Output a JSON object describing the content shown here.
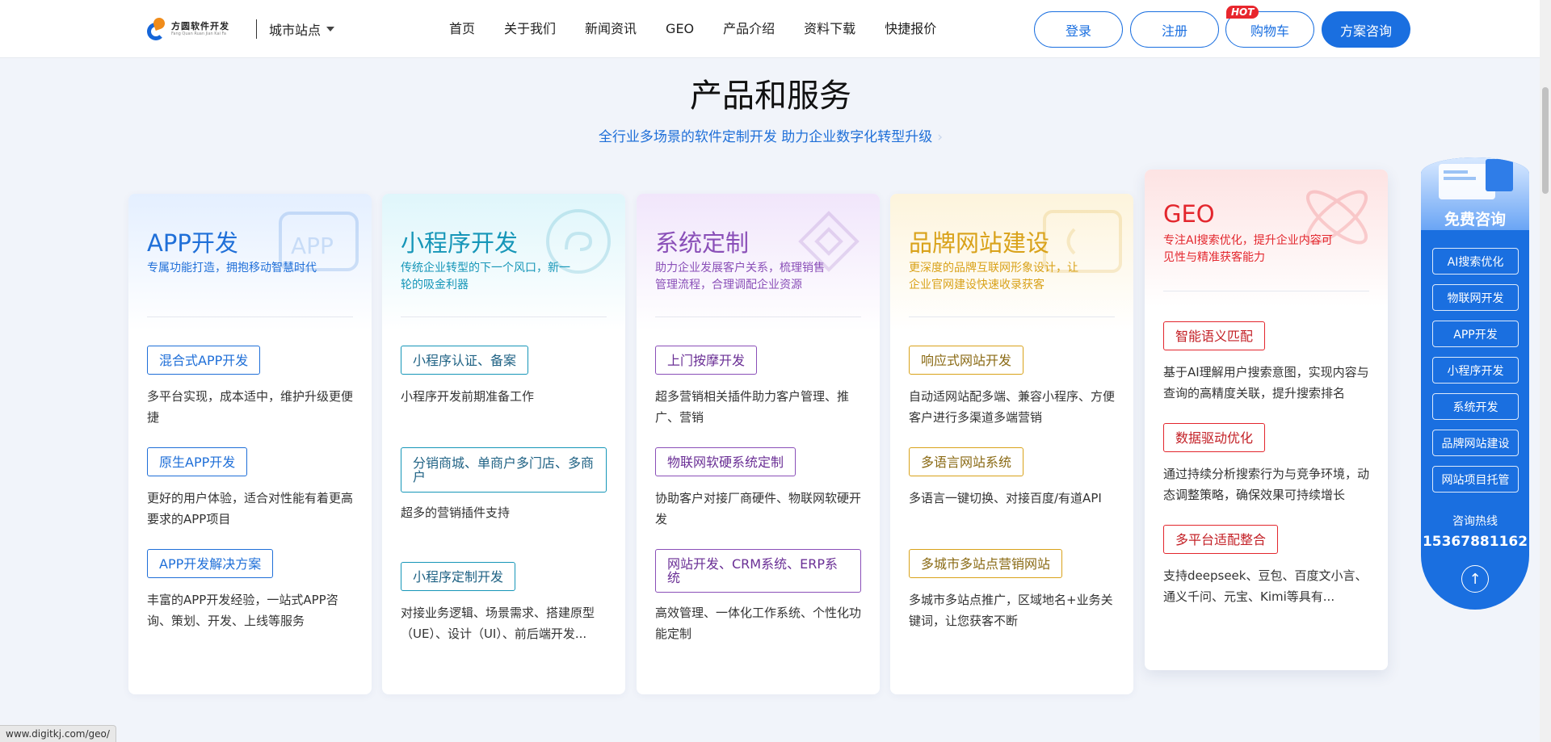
{
  "header": {
    "logo_cn": "方圆软件开发",
    "logo_en": "Fang Quan Ruan Jian Kai Fa",
    "city": "城市站点",
    "nav": [
      "首页",
      "关于我们",
      "新闻资讯",
      "GEO",
      "产品介绍",
      "资料下载",
      "快捷报价"
    ],
    "login": "登录",
    "register": "注册",
    "cart": "购物车",
    "hot": "HOT",
    "consult": "方案咨询",
    "accent_color": "#1a6fe0"
  },
  "section": {
    "title": "产品和服务",
    "subtitle": "全行业多场景的软件定制开发 助力企业数字化转型升级"
  },
  "cards": [
    {
      "title": "APP开发",
      "desc": "专属功能打造，拥抱移动智慧时代",
      "color": "#1f6fd8",
      "items": [
        {
          "tag": "混合式APP开发",
          "text": "多平台实现，成本适中，维护升级更便捷"
        },
        {
          "tag": "原生APP开发",
          "text": "更好的用户体验，适合对性能有着更高要求的APP项目"
        },
        {
          "tag": "APP开发解决方案",
          "text": "丰富的APP开发经验，一站式APP咨询、策划、开发、上线等服务"
        }
      ]
    },
    {
      "title": "小程序开发",
      "desc": "传统企业转型的下一个风口，新一轮的吸金利器",
      "color": "#1696b8",
      "items": [
        {
          "tag": "小程序认证、备案",
          "text": "小程序开发前期准备工作"
        },
        {
          "tag": "分销商城、单商户多门店、多商户",
          "text": "超多的营销插件支持"
        },
        {
          "tag": "小程序定制开发",
          "text": "对接业务逻辑、场景需求、搭建原型（UE）、设计（UI）、前后端开发..."
        }
      ]
    },
    {
      "title": "系统定制",
      "desc": "助力企业发展客户关系，梳理销售管理流程，合理调配企业资源",
      "color": "#8a4fb8",
      "items": [
        {
          "tag": "上门按摩开发",
          "text": "超多营销相关插件助力客户管理、推广、营销"
        },
        {
          "tag": "物联网软硬系统定制",
          "text": "协助客户对接厂商硬件、物联网软硬开发"
        },
        {
          "tag": "网站开发、CRM系统、ERP系统",
          "text": "高效管理、一体化工作系统、个性化功能定制"
        }
      ]
    },
    {
      "title": "品牌网站建设",
      "desc": "更深度的品牌互联网形象设计，让企业官网建设快速收录获客",
      "color": "#d9a21a",
      "items": [
        {
          "tag": "响应式网站开发",
          "text": "自动适网站配多端、兼容小程序、方便客户进行多渠道多端营销"
        },
        {
          "tag": "多语言网站系统",
          "text": "多语言一键切换、对接百度/有道API"
        },
        {
          "tag": "多城市多站点营销网站",
          "text": "多城市多站点推广，区域地名+业务关键词，让您获客不断"
        }
      ]
    },
    {
      "title": "GEO",
      "desc": "专注AI搜索优化，提升企业内容可见性与精准获客能力",
      "color": "#e3262d",
      "items": [
        {
          "tag": "智能语义匹配",
          "text": "基于AI理解用户搜索意图，实现内容与查询的高精度关联，提升搜索排名"
        },
        {
          "tag": "数据驱动优化",
          "text": "通过持续分析搜索行为与竞争环境，动态调整策略，确保效果可持续增长"
        },
        {
          "tag": "多平台适配整合",
          "text": "支持deepseek、豆包、百度文小言、通义千问、元宝、Kimi等具有..."
        }
      ]
    }
  ],
  "consult": {
    "title": "免费咨询",
    "buttons": [
      "AI搜索优化",
      "物联网开发",
      "APP开发",
      "小程序开发",
      "系统开发",
      "品牌网站建设",
      "网站项目托管"
    ],
    "hotline_label": "咨询热线",
    "phone": "15367881162"
  },
  "status_url": "www.digitkj.com/geo/"
}
